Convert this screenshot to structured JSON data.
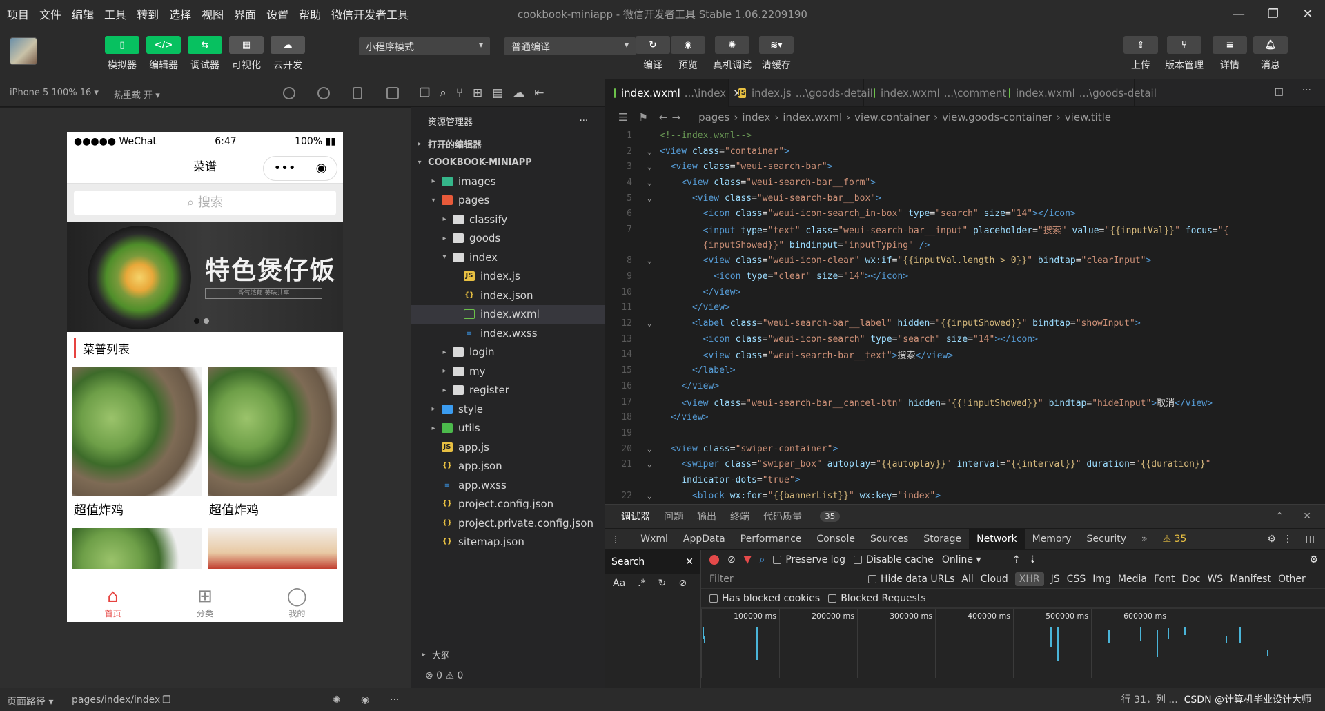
{
  "menu": [
    "项目",
    "文件",
    "编辑",
    "工具",
    "转到",
    "选择",
    "视图",
    "界面",
    "设置",
    "帮助",
    "微信开发者工具"
  ],
  "window_title": "cookbook-miniapp - 微信开发者工具 Stable 1.06.2209190",
  "toolbar": {
    "left_buttons": [
      "模拟器",
      "编辑器",
      "调试器",
      "可视化",
      "云开发"
    ],
    "mode_select": "小程序模式",
    "compile_select": "普通编译",
    "mid_buttons": [
      "编译",
      "预览",
      "真机调试",
      "清缓存"
    ],
    "right_buttons": [
      "上传",
      "版本管理",
      "详情",
      "消息"
    ]
  },
  "simbar": {
    "device": "iPhone 5 100% 16",
    "hot_reload": "热重载 开"
  },
  "phone": {
    "carrier": "●●●●● WeChat",
    "time": "6:47",
    "battery": "100%",
    "nav_title": "菜谱",
    "search_placeholder": "搜索",
    "banner_title": "特色煲仔饭",
    "banner_sub": "香气浓郁  美味共享",
    "list_title": "菜普列表",
    "cards": [
      "超值炸鸡",
      "超值炸鸡"
    ],
    "tabs": [
      {
        "label": "首页",
        "icon": "⌂"
      },
      {
        "label": "分类",
        "icon": "⊞"
      },
      {
        "label": "我的",
        "icon": "◯"
      }
    ]
  },
  "pathbar": {
    "label": "页面路径",
    "path": "pages/index/index"
  },
  "explorer": {
    "title": "资源管理器",
    "open_editors": "打开的编辑器",
    "project": "COOKBOOK-MINIAPP",
    "outline": "大纲",
    "status": "⊗ 0 ⚠ 0",
    "tree": [
      {
        "name": "images",
        "depth": 1,
        "type": "fimg",
        "arrow": "▸"
      },
      {
        "name": "pages",
        "depth": 1,
        "type": "fpages",
        "arrow": "▾"
      },
      {
        "name": "classify",
        "depth": 2,
        "type": "folder",
        "arrow": "▸"
      },
      {
        "name": "goods",
        "depth": 2,
        "type": "folder",
        "arrow": "▸"
      },
      {
        "name": "index",
        "depth": 2,
        "type": "folder",
        "arrow": "▾"
      },
      {
        "name": "index.js",
        "depth": 3,
        "type": "js",
        "arrow": ""
      },
      {
        "name": "index.json",
        "depth": 3,
        "type": "json",
        "arrow": ""
      },
      {
        "name": "index.wxml",
        "depth": 3,
        "type": "wxml",
        "arrow": "",
        "selected": true
      },
      {
        "name": "index.wxss",
        "depth": 3,
        "type": "wxss",
        "arrow": ""
      },
      {
        "name": "login",
        "depth": 2,
        "type": "folder",
        "arrow": "▸"
      },
      {
        "name": "my",
        "depth": 2,
        "type": "folder",
        "arrow": "▸"
      },
      {
        "name": "register",
        "depth": 2,
        "type": "folder",
        "arrow": "▸"
      },
      {
        "name": "style",
        "depth": 1,
        "type": "fstyle",
        "arrow": "▸"
      },
      {
        "name": "utils",
        "depth": 1,
        "type": "futils",
        "arrow": "▸"
      },
      {
        "name": "app.js",
        "depth": 1,
        "type": "js",
        "arrow": ""
      },
      {
        "name": "app.json",
        "depth": 1,
        "type": "json",
        "arrow": ""
      },
      {
        "name": "app.wxss",
        "depth": 1,
        "type": "wxss",
        "arrow": ""
      },
      {
        "name": "project.config.json",
        "depth": 1,
        "type": "json",
        "arrow": ""
      },
      {
        "name": "project.private.config.json",
        "depth": 1,
        "type": "json",
        "arrow": ""
      },
      {
        "name": "sitemap.json",
        "depth": 1,
        "type": "json",
        "arrow": ""
      }
    ]
  },
  "editor": {
    "tabs": [
      {
        "file": "index.wxml",
        "path": "...\\index",
        "active": true
      },
      {
        "file": "index.js",
        "path": "...\\goods-detail",
        "active": false
      },
      {
        "file": "index.wxml",
        "path": "...\\comment",
        "active": false
      },
      {
        "file": "index.wxml",
        "path": "...\\goods-detail",
        "active": false
      }
    ],
    "breadcrumb": [
      "pages",
      "index",
      "index.wxml",
      "view.container",
      "view.goods-container",
      "view.title"
    ],
    "lines": [
      {
        "n": "1",
        "f": "",
        "h": "<span class='cm'>&lt;!--index.wxml--&gt;</span>"
      },
      {
        "n": "2",
        "f": "⌄",
        "h": "<span class='tg'>&lt;view</span> <span class='at'>class</span>=<span class='st'>\"container\"</span><span class='tg'>&gt;</span>"
      },
      {
        "n": "3",
        "f": "⌄",
        "h": "  <span class='tg'>&lt;view</span> <span class='at'>class</span>=<span class='st'>\"weui-search-bar\"</span><span class='tg'>&gt;</span>"
      },
      {
        "n": "4",
        "f": "⌄",
        "h": "    <span class='tg'>&lt;view</span> <span class='at'>class</span>=<span class='st'>\"weui-search-bar__form\"</span><span class='tg'>&gt;</span>"
      },
      {
        "n": "5",
        "f": "⌄",
        "h": "      <span class='tg'>&lt;view</span> <span class='at'>class</span>=<span class='st'>\"weui-search-bar__box\"</span><span class='tg'>&gt;</span>"
      },
      {
        "n": "6",
        "f": "",
        "h": "        <span class='tg'>&lt;icon</span> <span class='at'>class</span>=<span class='st'>\"weui-icon-search_in-box\"</span> <span class='at'>type</span>=<span class='st'>\"search\"</span> <span class='at'>size</span>=<span class='st'>\"14\"</span><span class='tg'>&gt;&lt;/icon&gt;</span>"
      },
      {
        "n": "7",
        "f": "",
        "h": "        <span class='tg'>&lt;input</span> <span class='at'>type</span>=<span class='st'>\"text\"</span> <span class='at'>class</span>=<span class='st'>\"weui-search-bar__input\"</span> <span class='at'>placeholder</span>=<span class='st'>\"搜索\"</span> <span class='at'>value</span>=<span class='st'>\"<span class='mu'>{{inputVal}}</span>\"</span> <span class='at'>focus</span>=<span class='st'>\"{</span>"
      },
      {
        "n": "",
        "f": "",
        "h": "        <span class='st'>{inputShowed}}\"</span> <span class='at'>bindinput</span>=<span class='st'>\"inputTyping\"</span> <span class='tg'>/&gt;</span>"
      },
      {
        "n": "8",
        "f": "⌄",
        "h": "        <span class='tg'>&lt;view</span> <span class='at'>class</span>=<span class='st'>\"weui-icon-clear\"</span> <span class='at'>wx:if</span>=<span class='st'>\"<span class='mu'>{{inputVal.length &gt; 0}}</span>\"</span> <span class='at'>bindtap</span>=<span class='st'>\"clearInput\"</span><span class='tg'>&gt;</span>"
      },
      {
        "n": "9",
        "f": "",
        "h": "          <span class='tg'>&lt;icon</span> <span class='at'>type</span>=<span class='st'>\"clear\"</span> <span class='at'>size</span>=<span class='st'>\"14\"</span><span class='tg'>&gt;&lt;/icon&gt;</span>"
      },
      {
        "n": "10",
        "f": "",
        "h": "        <span class='tg'>&lt;/view&gt;</span>"
      },
      {
        "n": "11",
        "f": "",
        "h": "      <span class='tg'>&lt;/view&gt;</span>"
      },
      {
        "n": "12",
        "f": "⌄",
        "h": "      <span class='tg'>&lt;label</span> <span class='at'>class</span>=<span class='st'>\"weui-search-bar__label\"</span> <span class='at'>hidden</span>=<span class='st'>\"<span class='mu'>{{inputShowed}}</span>\"</span> <span class='at'>bindtap</span>=<span class='st'>\"showInput\"</span><span class='tg'>&gt;</span>"
      },
      {
        "n": "13",
        "f": "",
        "h": "        <span class='tg'>&lt;icon</span> <span class='at'>class</span>=<span class='st'>\"weui-icon-search\"</span> <span class='at'>type</span>=<span class='st'>\"search\"</span> <span class='at'>size</span>=<span class='st'>\"14\"</span><span class='tg'>&gt;&lt;/icon&gt;</span>"
      },
      {
        "n": "14",
        "f": "",
        "h": "        <span class='tg'>&lt;view</span> <span class='at'>class</span>=<span class='st'>\"weui-search-bar__text\"</span><span class='tg'>&gt;</span>搜索<span class='tg'>&lt;/view&gt;</span>"
      },
      {
        "n": "15",
        "f": "",
        "h": "      <span class='tg'>&lt;/label&gt;</span>"
      },
      {
        "n": "16",
        "f": "",
        "h": "    <span class='tg'>&lt;/view&gt;</span>"
      },
      {
        "n": "17",
        "f": "",
        "h": "    <span class='tg'>&lt;view</span> <span class='at'>class</span>=<span class='st'>\"weui-search-bar__cancel-btn\"</span> <span class='at'>hidden</span>=<span class='st'>\"<span class='mu'>{{!inputShowed}}</span>\"</span> <span class='at'>bindtap</span>=<span class='st'>\"hideInput\"</span><span class='tg'>&gt;</span>取消<span class='tg'>&lt;/view&gt;</span>"
      },
      {
        "n": "18",
        "f": "",
        "h": "  <span class='tg'>&lt;/view&gt;</span>"
      },
      {
        "n": "19",
        "f": "",
        "h": ""
      },
      {
        "n": "20",
        "f": "⌄",
        "h": "  <span class='tg'>&lt;view</span> <span class='at'>class</span>=<span class='st'>\"swiper-container\"</span><span class='tg'>&gt;</span>"
      },
      {
        "n": "21",
        "f": "⌄",
        "h": "    <span class='tg'>&lt;swiper</span> <span class='at'>class</span>=<span class='st'>\"swiper_box\"</span> <span class='at'>autoplay</span>=<span class='st'>\"<span class='mu'>{{autoplay}}</span>\"</span> <span class='at'>interval</span>=<span class='st'>\"<span class='mu'>{{interval}}</span>\"</span> <span class='at'>duration</span>=<span class='st'>\"<span class='mu'>{{duration}}</span>\"</span>"
      },
      {
        "n": "",
        "f": "",
        "h": "    <span class='at'>indicator-dots</span>=<span class='st'>\"true\"</span><span class='tg'>&gt;</span>"
      },
      {
        "n": "22",
        "f": "⌄",
        "h": "      <span class='tg'>&lt;block</span> <span class='at'>wx:for</span>=<span class='st'>\"<span class='mu'>{{bannerList}}</span>\"</span> <span class='at'>wx:key</span>=<span class='st'>\"index\"</span><span class='tg'>&gt;</span>"
      }
    ]
  },
  "devtools": {
    "top_tabs": [
      "调试器",
      "问题",
      "输出",
      "终端",
      "代码质量"
    ],
    "debugger_count": "35",
    "tabs": [
      "Wxml",
      "AppData",
      "Performance",
      "Console",
      "Sources",
      "Storage",
      "Network",
      "Memory",
      "Security"
    ],
    "more": "»",
    "warn": "⚠ 35",
    "search_label": "Search",
    "preserve_log": "Preserve log",
    "disable_cache": "Disable cache",
    "throttle": "Online",
    "filter_placeholder": "Filter",
    "hide_data": "Hide data URLs",
    "types": [
      "All",
      "Cloud",
      "XHR",
      "JS",
      "CSS",
      "Img",
      "Media",
      "Font",
      "Doc",
      "WS",
      "Manifest",
      "Other"
    ],
    "blocked_cookies": "Has blocked cookies",
    "blocked_requests": "Blocked Requests",
    "timeline": [
      "100000 ms",
      "200000 ms",
      "300000 ms",
      "400000 ms",
      "500000 ms",
      "600000 ms"
    ]
  },
  "status_right": "行 31，列 ...",
  "watermark": "CSDN @计算机毕业设计大师"
}
